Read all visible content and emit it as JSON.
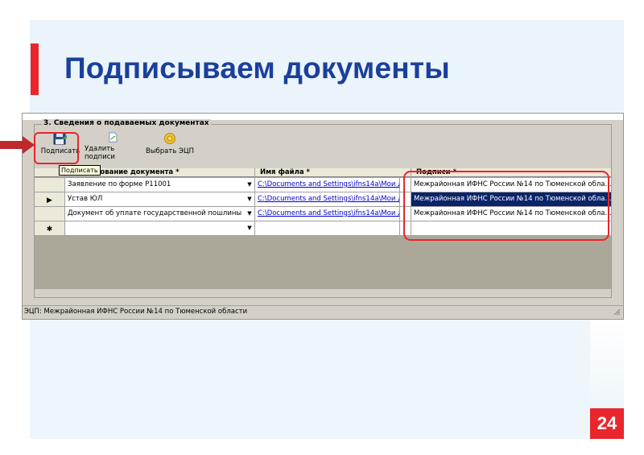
{
  "slide": {
    "title": "Подписываем документы",
    "page_number": "24",
    "colors": {
      "accent_red": "#e8262c",
      "title_blue": "#1b3f9c"
    }
  },
  "app": {
    "group_title": "3. Сведения о подаваемых документах",
    "toolbar": {
      "sign_label": "Подписать",
      "sign_icon": "floppy-sign-icon",
      "delete_label": "Удалить подписи",
      "delete_icon": "document-icon",
      "select_ecp_label": "Выбрать ЭЦП",
      "select_ecp_icon": "seal-icon"
    },
    "tooltip": "Подписать",
    "table": {
      "columns": [
        "Наименование документа *",
        "Имя файла *",
        "Подписи *"
      ],
      "rows": [
        {
          "indicator": "",
          "doc": "Заявление по форме Р11001",
          "file": "C:\\Documents and Settings\\ifns14a\\Мои д...",
          "signature": "Межрайонная ИФНС России №14 по Тюменской обла..."
        },
        {
          "indicator": "▶",
          "doc": "Устав ЮЛ",
          "file": "C:\\Documents and Settings\\ifns14a\\Мои д...",
          "signature": "Межрайонная ИФНС России №14 по Тюменской обла..."
        },
        {
          "indicator": "",
          "doc": "Документ об уплате государственной пошлины",
          "file": "C:\\Documents and Settings\\ifns14a\\Мои д...",
          "signature": "Межрайонная ИФНС России №14 по Тюменской обла..."
        },
        {
          "indicator": "✱",
          "doc": "",
          "file": "",
          "signature": ""
        }
      ]
    },
    "status_bar": "ЭЦП: Межрайонная ИФНС России №14 по Тюменской области"
  }
}
